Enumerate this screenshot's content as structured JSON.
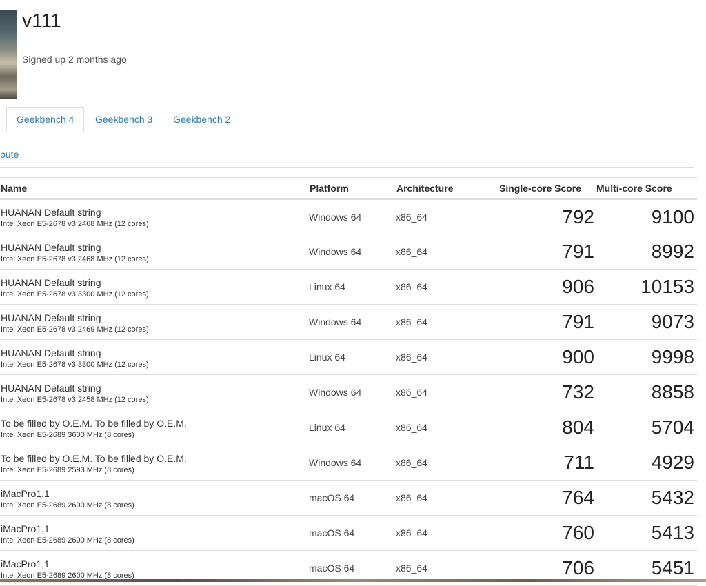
{
  "profile": {
    "username": "v111",
    "signed_up": "Signed up 2 months ago"
  },
  "tabs": [
    {
      "label": "Geekbench 4",
      "active": true
    },
    {
      "label": "Geekbench 3",
      "active": false
    },
    {
      "label": "Geekbench 2",
      "active": false
    }
  ],
  "subnav": {
    "label": "pute"
  },
  "table": {
    "headers": {
      "name": "Name",
      "platform": "Platform",
      "architecture": "Architecture",
      "single": "Single-core Score",
      "multi": "Multi-core Score"
    },
    "rows": [
      {
        "model": "HUANAN Default string",
        "cpu": "Intel Xeon E5-2678 v3 2468 MHz (12 cores)",
        "platform": "Windows 64",
        "arch": "x86_64",
        "single": "792",
        "multi": "9100"
      },
      {
        "model": "HUANAN Default string",
        "cpu": "Intel Xeon E5-2678 v3 2468 MHz (12 cores)",
        "platform": "Windows 64",
        "arch": "x86_64",
        "single": "791",
        "multi": "8992"
      },
      {
        "model": "HUANAN Default string",
        "cpu": "Intel Xeon E5-2678 v3 3300 MHz (12 cores)",
        "platform": "Linux 64",
        "arch": "x86_64",
        "single": "906",
        "multi": "10153"
      },
      {
        "model": "HUANAN Default string",
        "cpu": "Intel Xeon E5-2678 v3 2469 MHz (12 cores)",
        "platform": "Windows 64",
        "arch": "x86_64",
        "single": "791",
        "multi": "9073"
      },
      {
        "model": "HUANAN Default string",
        "cpu": "Intel Xeon E5-2678 v3 3300 MHz (12 cores)",
        "platform": "Linux 64",
        "arch": "x86_64",
        "single": "900",
        "multi": "9998"
      },
      {
        "model": "HUANAN Default string",
        "cpu": "Intel Xeon E5-2678 v3 2458 MHz (12 cores)",
        "platform": "Windows 64",
        "arch": "x86_64",
        "single": "732",
        "multi": "8858"
      },
      {
        "model": "To be filled by O.E.M. To be filled by O.E.M.",
        "cpu": "Intel Xeon E5-2689 3600 MHz (8 cores)",
        "platform": "Linux 64",
        "arch": "x86_64",
        "single": "804",
        "multi": "5704"
      },
      {
        "model": "To be filled by O.E.M. To be filled by O.E.M.",
        "cpu": "Intel Xeon E5-2689 2593 MHz (8 cores)",
        "platform": "Windows 64",
        "arch": "x86_64",
        "single": "711",
        "multi": "4929"
      },
      {
        "model": "iMacPro1,1",
        "cpu": "Intel Xeon E5-2689 2600 MHz (8 cores)",
        "platform": "macOS 64",
        "arch": "x86_64",
        "single": "764",
        "multi": "5432"
      },
      {
        "model": "iMacPro1,1",
        "cpu": "Intel Xeon E5-2689 2600 MHz (8 cores)",
        "platform": "macOS 64",
        "arch": "x86_64",
        "single": "760",
        "multi": "5413"
      },
      {
        "model": "iMacPro1,1",
        "cpu": "Intel Xeon E5-2689 2600 MHz (8 cores)",
        "platform": "macOS 64",
        "arch": "x86_64",
        "single": "706",
        "multi": "5451"
      }
    ]
  },
  "colors": {
    "link": "#2a7ab0",
    "border": "#dddddd",
    "text": "#333333"
  }
}
